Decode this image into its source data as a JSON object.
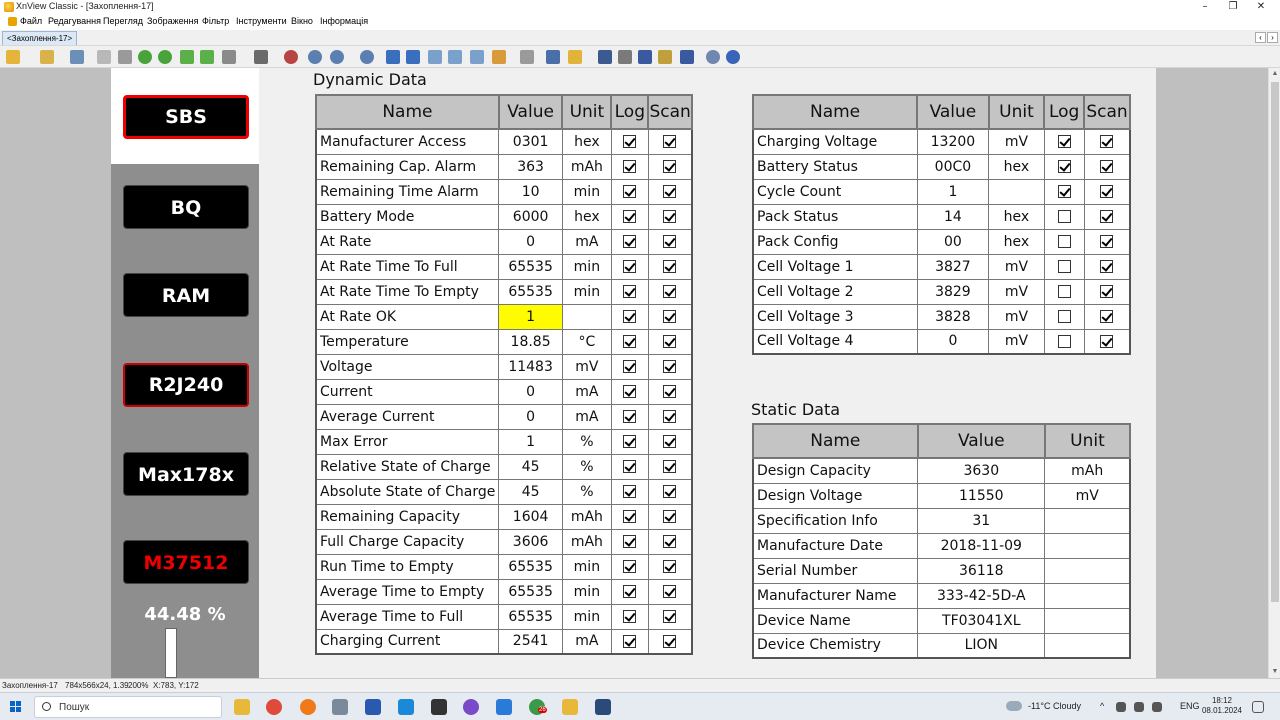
{
  "window": {
    "title": "XnView Classic - [Захоплення-17]",
    "controls": {
      "minimize": "–",
      "restore": "❐",
      "close": "✕"
    }
  },
  "menu": [
    "Файл",
    "Редагування",
    "Перегляд",
    "Зображення",
    "Фільтр",
    "Інструменти",
    "Вікно",
    "Інформація"
  ],
  "tabbar": {
    "tab": "<Захоплення-17>",
    "prev": "‹",
    "next": "›"
  },
  "side_buttons": [
    {
      "label": "SBS",
      "state": "active"
    },
    {
      "label": "BQ",
      "state": "normal"
    },
    {
      "label": "RAM",
      "state": "normal"
    },
    {
      "label": "R2J240",
      "state": "normal"
    },
    {
      "label": "Max178x",
      "state": "normal"
    },
    {
      "label": "M37512",
      "state": "alert"
    }
  ],
  "charge_percent_text": "44.48 %",
  "dynamic_title": "Dynamic Data",
  "dynamic_headers": [
    "Name",
    "Value",
    "Unit",
    "Log",
    "Scan"
  ],
  "dynamic_rows": [
    {
      "name": "Manufacturer Access",
      "value": "0301",
      "unit": "hex",
      "log": true,
      "scan": true
    },
    {
      "name": "Remaining Cap. Alarm",
      "value": "363",
      "unit": "mAh",
      "log": true,
      "scan": true
    },
    {
      "name": "Remaining Time Alarm",
      "value": "10",
      "unit": "min",
      "log": true,
      "scan": true
    },
    {
      "name": "Battery Mode",
      "value": "6000",
      "unit": "hex",
      "log": true,
      "scan": true
    },
    {
      "name": "At Rate",
      "value": "0",
      "unit": "mA",
      "log": true,
      "scan": true
    },
    {
      "name": "At Rate Time To Full",
      "value": "65535",
      "unit": "min",
      "log": true,
      "scan": true
    },
    {
      "name": "At Rate Time To Empty",
      "value": "65535",
      "unit": "min",
      "log": true,
      "scan": true
    },
    {
      "name": "At Rate OK",
      "value": "1",
      "unit": "",
      "log": true,
      "scan": true,
      "highlight": true
    },
    {
      "name": "Temperature",
      "value": "18.85",
      "unit": "°C",
      "log": true,
      "scan": true
    },
    {
      "name": "Voltage",
      "value": "11483",
      "unit": "mV",
      "log": true,
      "scan": true
    },
    {
      "name": "Current",
      "value": "0",
      "unit": "mA",
      "log": true,
      "scan": true
    },
    {
      "name": "Average Current",
      "value": "0",
      "unit": "mA",
      "log": true,
      "scan": true
    },
    {
      "name": "Max Error",
      "value": "1",
      "unit": "%",
      "log": true,
      "scan": true
    },
    {
      "name": "Relative State of Charge",
      "value": "45",
      "unit": "%",
      "log": true,
      "scan": true
    },
    {
      "name": "Absolute State of Charge",
      "value": "45",
      "unit": "%",
      "log": true,
      "scan": true
    },
    {
      "name": "Remaining Capacity",
      "value": "1604",
      "unit": "mAh",
      "log": true,
      "scan": true
    },
    {
      "name": "Full Charge Capacity",
      "value": "3606",
      "unit": "mAh",
      "log": true,
      "scan": true
    },
    {
      "name": "Run Time to Empty",
      "value": "65535",
      "unit": "min",
      "log": true,
      "scan": true
    },
    {
      "name": "Average Time to Empty",
      "value": "65535",
      "unit": "min",
      "log": true,
      "scan": true
    },
    {
      "name": "Average Time to Full",
      "value": "65535",
      "unit": "min",
      "log": true,
      "scan": true
    },
    {
      "name": "Charging Current",
      "value": "2541",
      "unit": "mA",
      "log": true,
      "scan": true
    }
  ],
  "right_headers": [
    "Name",
    "Value",
    "Unit",
    "Log",
    "Scan"
  ],
  "right_rows": [
    {
      "name": "Charging Voltage",
      "value": "13200",
      "unit": "mV",
      "log": true,
      "scan": true
    },
    {
      "name": "Battery Status",
      "value": "00C0",
      "unit": "hex",
      "log": true,
      "scan": true
    },
    {
      "name": "Cycle Count",
      "value": "1",
      "unit": "",
      "log": true,
      "scan": true
    },
    {
      "name": "Pack Status",
      "value": "14",
      "unit": "hex",
      "log": false,
      "scan": true
    },
    {
      "name": "Pack Config",
      "value": "00",
      "unit": "hex",
      "log": false,
      "scan": true
    },
    {
      "name": "Cell Voltage 1",
      "value": "3827",
      "unit": "mV",
      "log": false,
      "scan": true
    },
    {
      "name": "Cell Voltage 2",
      "value": "3829",
      "unit": "mV",
      "log": false,
      "scan": true
    },
    {
      "name": "Cell Voltage 3",
      "value": "3828",
      "unit": "mV",
      "log": false,
      "scan": true
    },
    {
      "name": "Cell Voltage 4",
      "value": "0",
      "unit": "mV",
      "log": false,
      "scan": true
    }
  ],
  "static_title": "Static Data",
  "static_headers": [
    "Name",
    "Value",
    "Unit"
  ],
  "static_rows": [
    {
      "name": "Design Capacity",
      "value": "3630",
      "unit": "mAh"
    },
    {
      "name": "Design Voltage",
      "value": "11550",
      "unit": "mV"
    },
    {
      "name": "Specification Info",
      "value": "31",
      "unit": ""
    },
    {
      "name": "Manufacture Date",
      "value": "2018-11-09",
      "unit": ""
    },
    {
      "name": "Serial Number",
      "value": "36118",
      "unit": ""
    },
    {
      "name": "Manufacturer Name",
      "value": "333-42-5D-A",
      "unit": ""
    },
    {
      "name": "Device Name",
      "value": "TF03041XL",
      "unit": ""
    },
    {
      "name": "Device Chemistry",
      "value": "LION",
      "unit": ""
    }
  ],
  "status": {
    "filename": "Захоплення-17",
    "image_info": "784x566x24, 1.39",
    "zoom": "200%",
    "coords": "X:783, Y:172"
  },
  "taskbar": {
    "search_placeholder": "Пошук",
    "weather": "-11°C  Cloudy",
    "language": "ENG",
    "time": "18:12",
    "date": "08.01.2024",
    "badge_count": "26"
  },
  "colors": {
    "active_border": "#ee0000",
    "alert_text": "#ee0000",
    "highlight": "#fffc00",
    "table_header": "#c4c4c4"
  }
}
